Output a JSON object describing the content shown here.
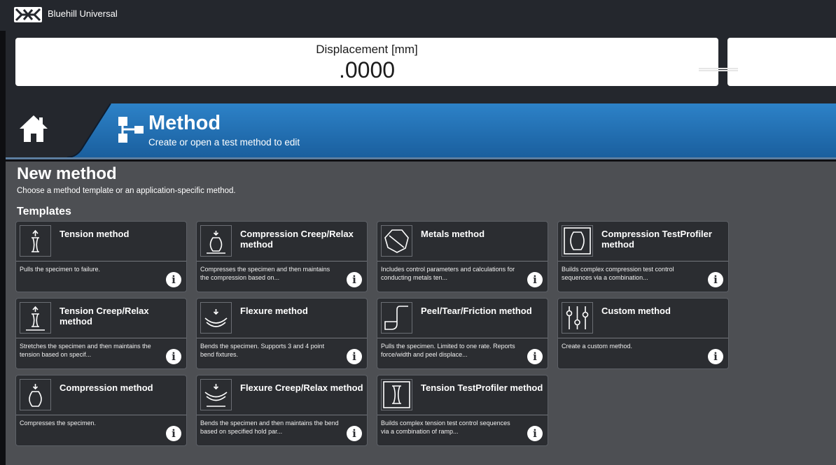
{
  "window": {
    "app_title": "Bluehill Universal",
    "logo_icon": "bluehill-logo"
  },
  "readout": {
    "label": "Displacement [mm]",
    "value": ".0000"
  },
  "header": {
    "home_icon": "home-icon",
    "title": "Method",
    "subtitle": "Create or open a test method to edit"
  },
  "page": {
    "title": "New method",
    "subtitle": "Choose a method template or an application-specific method.",
    "section": "Templates"
  },
  "templates": [
    {
      "name": "Tension method",
      "desc": "Pulls the specimen to failure.",
      "icon": "tension-icon"
    },
    {
      "name": "Compression Creep/Relax method",
      "desc": "Compresses the specimen and then maintains the compression based on...",
      "icon": "compression-creep-icon"
    },
    {
      "name": "Metals method",
      "desc": "Includes control parameters and calculations for conducting metals ten...",
      "icon": "metals-icon"
    },
    {
      "name": "Compression TestProfiler method",
      "desc": "Builds complex compression test control sequences via a combination...",
      "icon": "compression-testprofiler-icon"
    },
    {
      "name": "Tension Creep/Relax method",
      "desc": "Stretches the specimen and then maintains the tension based on specif...",
      "icon": "tension-creep-icon"
    },
    {
      "name": "Flexure method",
      "desc": "Bends the specimen.  Supports 3 and 4 point bend fixtures.",
      "icon": "flexure-icon"
    },
    {
      "name": "Peel/Tear/Friction method",
      "desc": "Pulls the specimen.  Limited to one rate. Reports force/width and peel displace...",
      "icon": "peel-icon"
    },
    {
      "name": "Custom method",
      "desc": "Create a custom method.",
      "icon": "custom-sliders-icon"
    },
    {
      "name": "Compression method",
      "desc": "Compresses the specimen.",
      "icon": "compression-icon"
    },
    {
      "name": "Flexure Creep/Relax method",
      "desc": "Bends the specimen and then maintains the bend based on specified hold par...",
      "icon": "flexure-creep-icon"
    },
    {
      "name": "Tension TestProfiler method",
      "desc": "Builds complex tension test control sequences via a combination of ramp...",
      "icon": "tension-testprofiler-icon"
    }
  ],
  "info_glyph": "i"
}
